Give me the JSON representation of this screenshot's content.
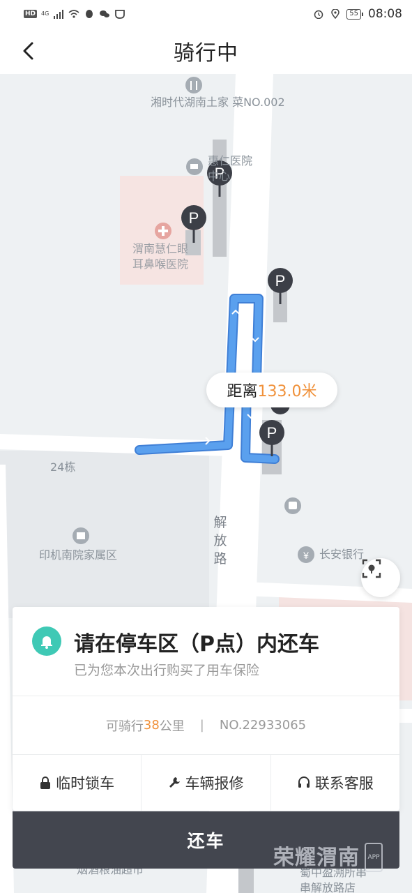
{
  "status_bar": {
    "hd": "HD",
    "network": "4G",
    "battery": "55",
    "time": "08:08"
  },
  "header": {
    "title": "骑行中"
  },
  "map": {
    "pois": {
      "restaurant": "湘时代湖南土家\n菜NO.002",
      "medical_center": "惠仁医院\n中心",
      "hospital": "渭南慧仁眼\n耳鼻喉医院",
      "building_24": "24栋",
      "residential": "印机南院家属区",
      "bank": "长安银行",
      "grocery": "烟酒粮油超市",
      "store": "蜀中盈溯所串\n串解放路店"
    },
    "road_name": "解放路",
    "distance": {
      "label": "距离",
      "value": "133.0米"
    }
  },
  "card": {
    "notice_title": "请在停车区（P点）内还车",
    "notice_subtitle": "已为您本次出行购买了用车保险",
    "range_prefix": "可骑行",
    "range_value": "38",
    "range_unit": "公里",
    "range_divider": "|",
    "bike_number": "NO.22933065",
    "actions": [
      {
        "label": "临时锁车",
        "icon": "lock-icon"
      },
      {
        "label": "车辆报修",
        "icon": "wrench-icon"
      },
      {
        "label": "联系客服",
        "icon": "headset-icon"
      }
    ],
    "return_label": "还车"
  },
  "watermark": {
    "text": "荣耀渭南",
    "app": "APP"
  },
  "colors": {
    "accent_orange": "#f0913a",
    "route_blue": "#4a90e2",
    "bell_teal": "#3fc9b5",
    "button_dark": "#43464f"
  }
}
